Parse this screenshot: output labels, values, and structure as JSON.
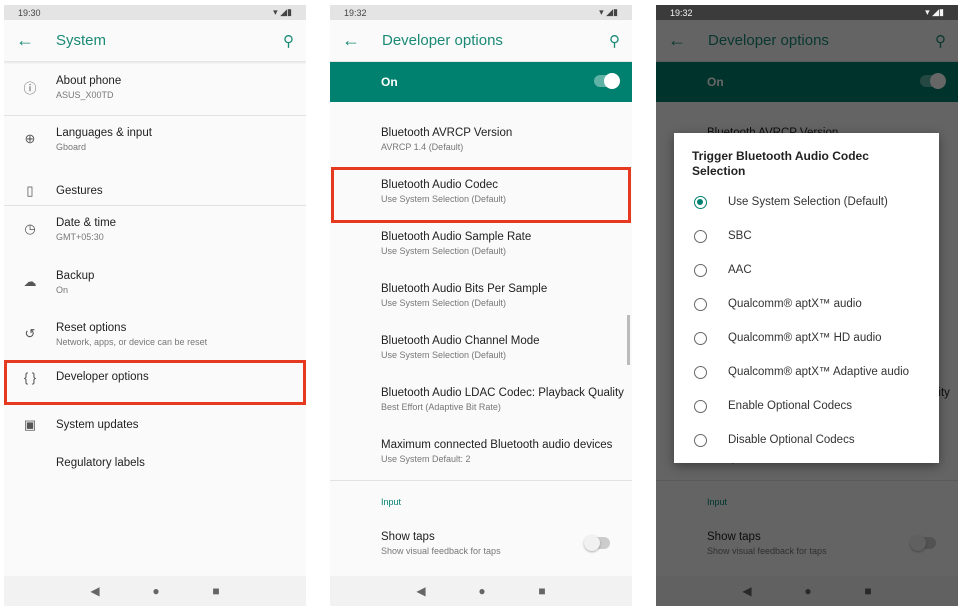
{
  "panel1": {
    "time": "19:30",
    "title": "System",
    "items": [
      {
        "label": "About phone",
        "sub": "ASUS_X00TD",
        "icon": "info-icon"
      },
      {
        "label": "Languages & input",
        "sub": "Gboard",
        "icon": "globe-icon"
      },
      {
        "label": "Gestures",
        "sub": "",
        "icon": "gestures-icon"
      },
      {
        "label": "Date & time",
        "sub": "GMT+05:30",
        "icon": "clock-icon"
      },
      {
        "label": "Backup",
        "sub": "On",
        "icon": "cloud-upload-icon"
      },
      {
        "label": "Reset options",
        "sub": "Network, apps, or device can be reset",
        "icon": "history-icon"
      },
      {
        "label": "Developer options",
        "sub": "",
        "icon": "braces-icon"
      },
      {
        "label": "System updates",
        "sub": "",
        "icon": "system-update-icon"
      },
      {
        "label": "Regulatory labels",
        "sub": "",
        "icon": ""
      }
    ]
  },
  "panel2": {
    "time": "19:32",
    "title": "Developer options",
    "master_switch": {
      "label": "On",
      "checked": true
    },
    "items": [
      {
        "label": "Bluetooth AVRCP Version",
        "sub": "AVRCP 1.4 (Default)"
      },
      {
        "label": "Bluetooth Audio Codec",
        "sub": "Use System Selection (Default)"
      },
      {
        "label": "Bluetooth Audio Sample Rate",
        "sub": "Use System Selection (Default)"
      },
      {
        "label": "Bluetooth Audio Bits Per Sample",
        "sub": "Use System Selection (Default)"
      },
      {
        "label": "Bluetooth Audio Channel Mode",
        "sub": "Use System Selection (Default)"
      },
      {
        "label": "Bluetooth Audio LDAC Codec: Playback Quality",
        "sub": "Best Effort (Adaptive Bit Rate)"
      },
      {
        "label": "Maximum connected Bluetooth audio devices",
        "sub": "Use System Default: 2"
      }
    ],
    "section": "Input",
    "show_taps": {
      "label": "Show taps",
      "sub": "Show visual feedback for taps",
      "checked": false
    }
  },
  "panel3": {
    "time": "19:32",
    "dialog": {
      "title": "Trigger Bluetooth Audio Codec Selection",
      "selected": 0,
      "options": [
        "Use System Selection (Default)",
        "SBC",
        "AAC",
        "Qualcomm® aptX™ audio",
        "Qualcomm® aptX™ HD audio",
        "Qualcomm® aptX™ Adaptive audio",
        "Enable Optional Codecs",
        "Disable Optional Codecs"
      ]
    }
  },
  "colors": {
    "accent": "#00806e",
    "highlight": "#e53a1f"
  }
}
